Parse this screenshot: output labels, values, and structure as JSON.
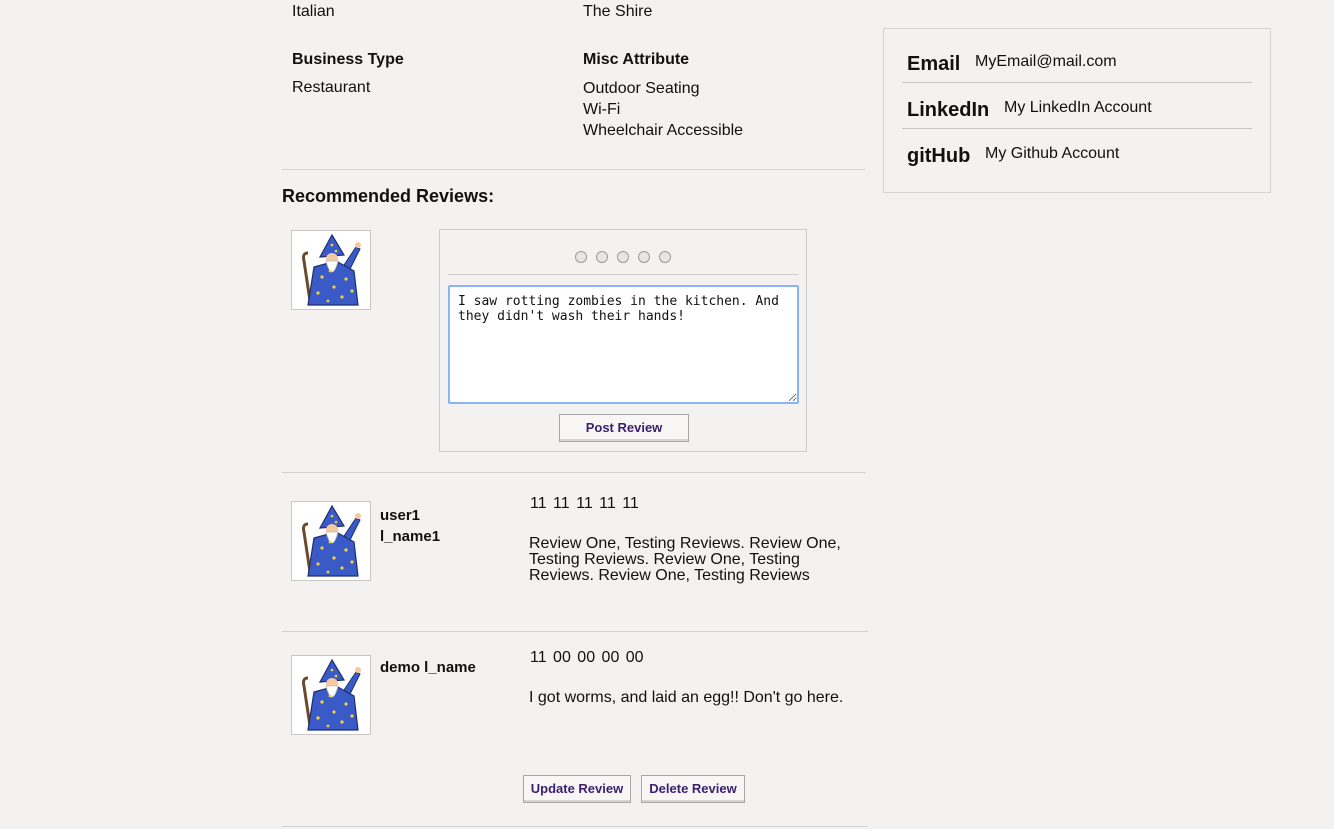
{
  "business": {
    "cuisine_value": "Italian",
    "location_value": "The Shire",
    "business_type_label": "Business Type",
    "business_type_value": "Restaurant",
    "misc_label": "Misc Attribute",
    "misc_values": [
      "Outdoor Seating",
      "Wi-Fi",
      "Wheelchair Accessible"
    ]
  },
  "reviews_heading": "Recommended Reviews:",
  "review_form": {
    "text": "I saw rotting zombies in the kitchen. And they didn't wash their hands!",
    "star_count": 5,
    "post_label": "Post Review"
  },
  "reviews": [
    {
      "username": "user1",
      "last_name": "l_name1",
      "rating_text": "11 11 11 11 11",
      "text": "Review One, Testing Reviews. Review One, Testing Reviews. Review One, Testing Reviews. Review One, Testing Reviews"
    },
    {
      "username": "demo l_name",
      "rating_text": "11 00 00 00 00",
      "text": "I got worms, and laid an egg!! Don't go here.",
      "update_label": "Update Review",
      "delete_label": "Delete Review"
    }
  ],
  "contact": {
    "email_label": "Email",
    "email_value": "MyEmail@mail.com",
    "linkedin_label": "LinkedIn",
    "linkedin_value": "My LinkedIn Account",
    "github_label": "gitHub",
    "github_value": "My Github Account"
  },
  "colors": {
    "background": "#f3f2f1",
    "button_text": "#3b1e6e",
    "textarea_focus": "#8ab4f8"
  }
}
